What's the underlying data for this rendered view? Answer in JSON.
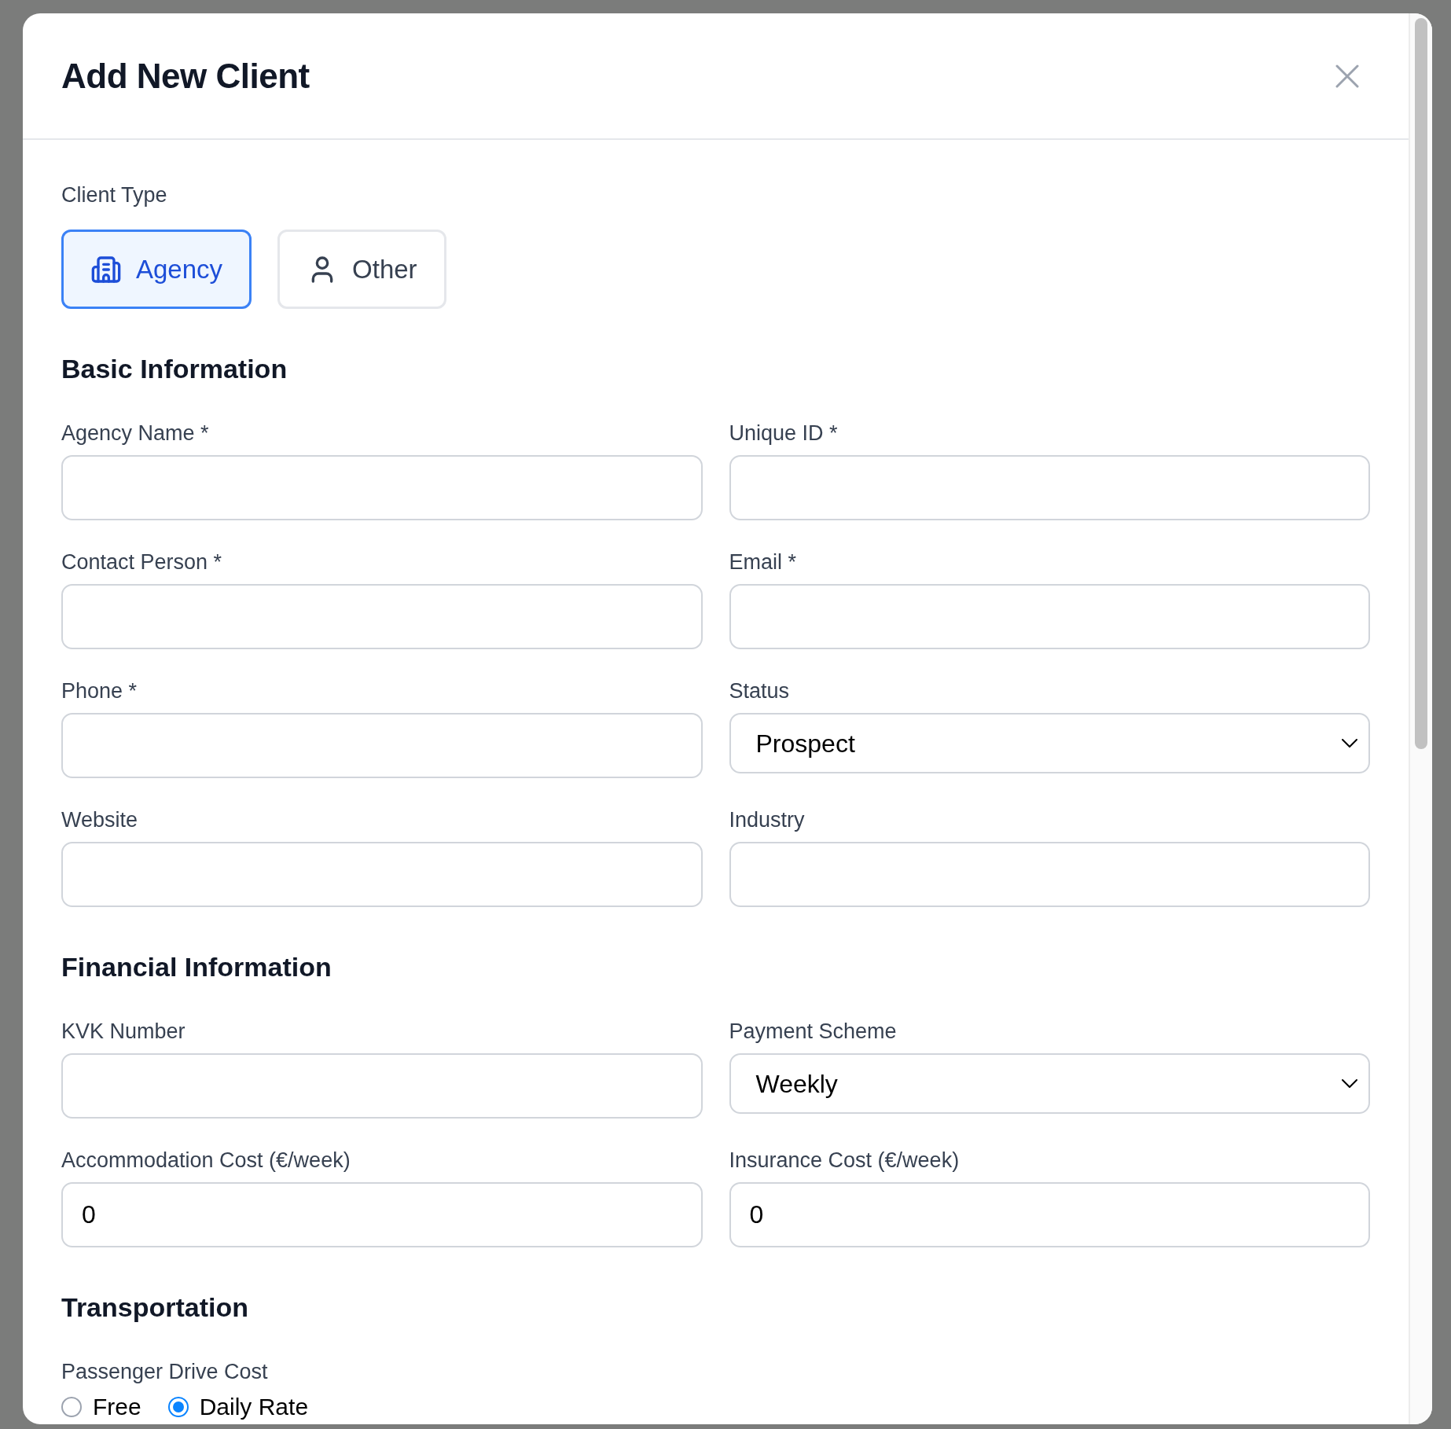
{
  "dialog": {
    "title": "Add New Client"
  },
  "client_type": {
    "label": "Client Type",
    "options": [
      {
        "label": "Agency",
        "selected": true
      },
      {
        "label": "Other",
        "selected": false
      }
    ]
  },
  "sections": [
    {
      "title": "Basic Information",
      "fields": [
        {
          "kind": "text",
          "label": "Agency Name *"
        },
        {
          "kind": "text",
          "label": "Unique ID *"
        },
        {
          "kind": "text",
          "label": "Contact Person *"
        },
        {
          "kind": "text",
          "label": "Email *"
        },
        {
          "kind": "text",
          "label": "Phone *"
        },
        {
          "kind": "select",
          "label": "Status",
          "value": "Prospect"
        },
        {
          "kind": "text",
          "label": "Website"
        },
        {
          "kind": "text",
          "label": "Industry"
        }
      ]
    },
    {
      "title": "Financial Information",
      "fields": [
        {
          "kind": "text",
          "label": "KVK Number"
        },
        {
          "kind": "select",
          "label": "Payment Scheme",
          "value": "Weekly"
        },
        {
          "kind": "text",
          "label": "Accommodation Cost (€/week)",
          "value": "0"
        },
        {
          "kind": "text",
          "label": "Insurance Cost (€/week)",
          "value": "0"
        }
      ]
    },
    {
      "title": "Transportation",
      "fields": [
        {
          "kind": "radio",
          "label": "Passenger Drive Cost",
          "options": [
            {
              "label": "Free",
              "selected": false
            },
            {
              "label": "Daily Rate",
              "selected": true
            }
          ]
        }
      ]
    }
  ]
}
